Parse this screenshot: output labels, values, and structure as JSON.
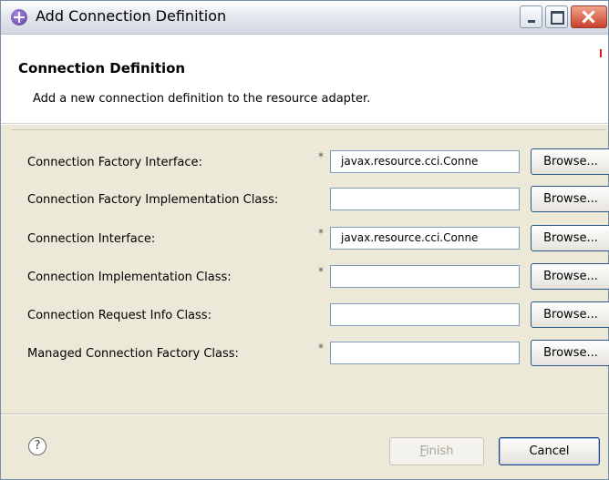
{
  "window": {
    "title": "Add Connection Definition",
    "icon": "eclipse-plugin-icon",
    "controls": [
      "minimize",
      "maximize",
      "close"
    ]
  },
  "header": {
    "title": "Connection Definition",
    "description": "Add a new connection definition to the resource adapter."
  },
  "form": {
    "required_marker": "*",
    "browse_label": "Browse...",
    "rows": [
      {
        "label": "Connection Factory Interface:",
        "value": "javax.resource.cci.Conne",
        "required": true
      },
      {
        "label": "Connection Factory Implementation Class:",
        "value": "",
        "required": true
      },
      {
        "label": "Connection Interface:",
        "value": "javax.resource.cci.Conne",
        "required": true
      },
      {
        "label": "Connection Implementation Class:",
        "value": "",
        "required": true
      },
      {
        "label": "Connection Request Info Class:",
        "value": "",
        "required": false
      },
      {
        "label": "Managed Connection Factory Class:",
        "value": "",
        "required": true
      }
    ]
  },
  "footer": {
    "help_icon": "?",
    "finish_label": "Finish",
    "finish_enabled": false,
    "cancel_label": "Cancel"
  },
  "colors": {
    "close_button": "#c9402b",
    "dialog_background": "#ece9d8",
    "header_background": "#ffffff"
  }
}
